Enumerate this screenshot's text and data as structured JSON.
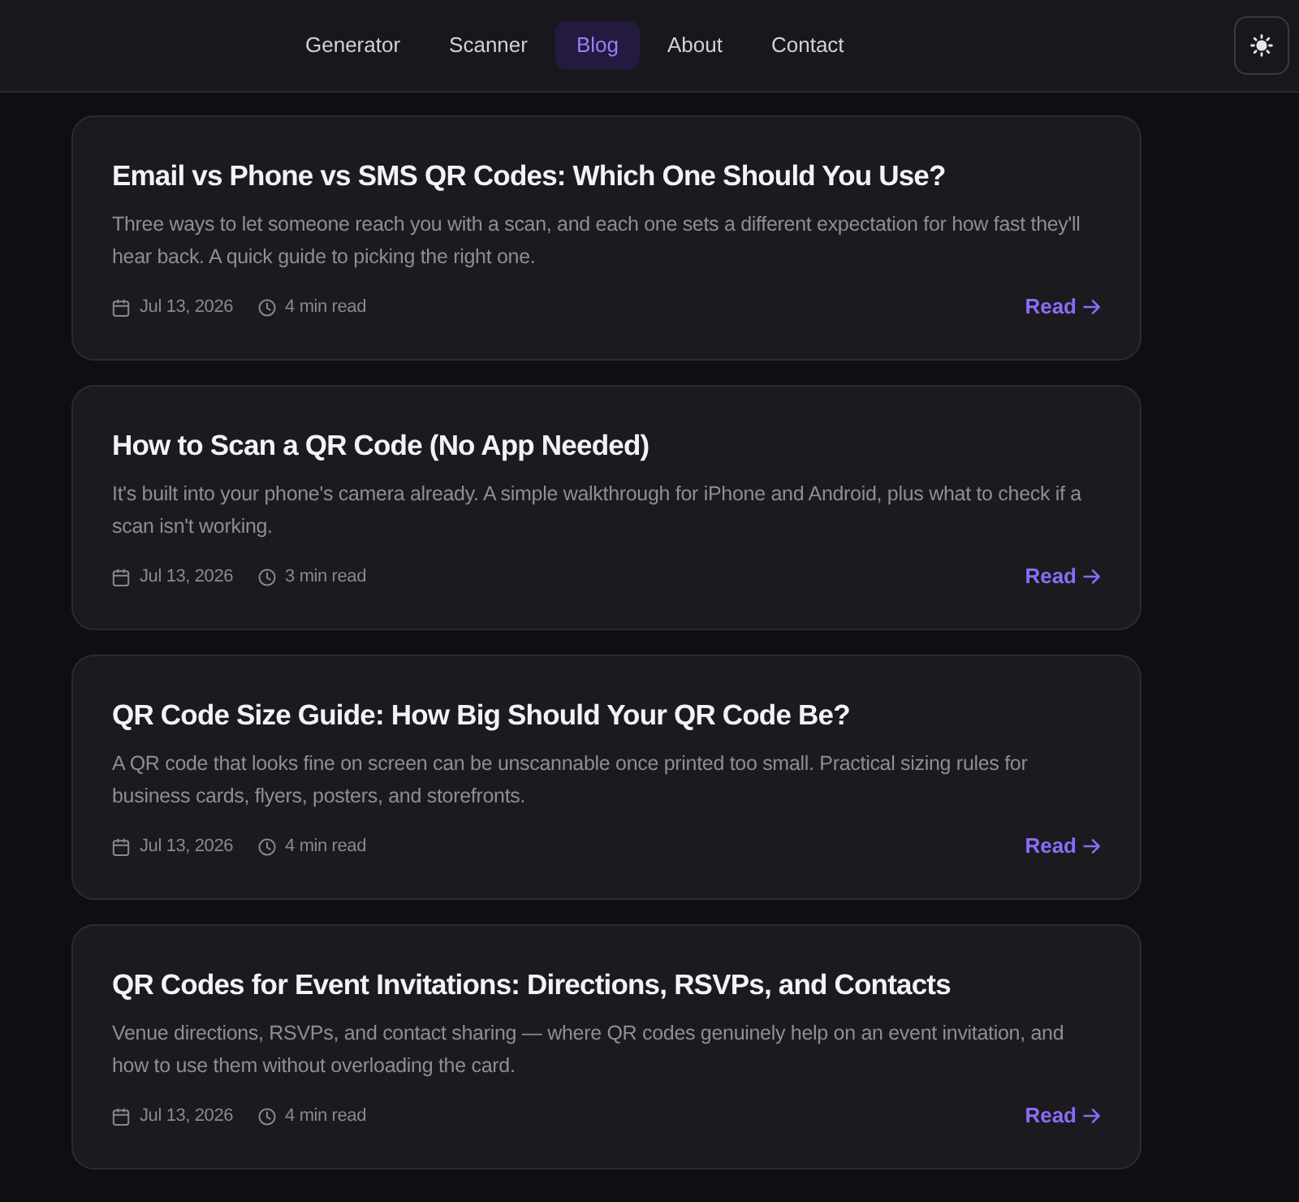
{
  "nav": {
    "links": [
      {
        "label": "Generator",
        "selected": false
      },
      {
        "label": "Scanner",
        "selected": false
      },
      {
        "label": "Blog",
        "selected": true
      },
      {
        "label": "About",
        "selected": false
      },
      {
        "label": "Contact",
        "selected": false
      }
    ]
  },
  "posts": [
    {
      "title": "Email vs Phone vs SMS QR Codes: Which One Should You Use?",
      "excerpt": "Three ways to let someone reach you with a scan, and each one sets a different expectation for how fast they'll hear back. A quick guide to picking the right one.",
      "date": "Jul 13, 2026",
      "read_time": "4 min read",
      "link": "Read"
    },
    {
      "title": "How to Scan a QR Code (No App Needed)",
      "excerpt": "It's built into your phone's camera already. A simple walkthrough for iPhone and Android, plus what to check if a scan isn't working.",
      "date": "Jul 13, 2026",
      "read_time": "3 min read",
      "link": "Read"
    },
    {
      "title": "QR Code Size Guide: How Big Should Your QR Code Be?",
      "excerpt": "A QR code that looks fine on screen can be unscannable once printed too small. Practical sizing rules for business cards, flyers, posters, and storefronts.",
      "date": "Jul 13, 2026",
      "read_time": "4 min read",
      "link": "Read"
    },
    {
      "title": "QR Codes for Event Invitations: Directions, RSVPs, and Contacts",
      "excerpt": "Venue directions, RSVPs, and contact sharing — where QR codes genuinely help on an event invitation, and how to use them without overloading the card.",
      "date": "Jul 13, 2026",
      "read_time": "4 min read",
      "link": "Read"
    }
  ]
}
